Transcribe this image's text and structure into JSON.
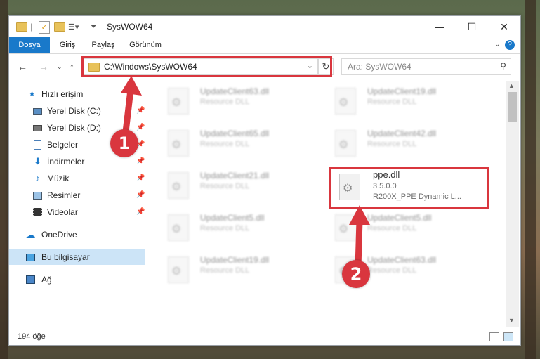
{
  "window": {
    "title": "SysWOW64",
    "controls": {
      "minimize": "—",
      "maximize": "☐",
      "close": "✕"
    }
  },
  "ribbon": {
    "tabs": [
      {
        "label": "Dosya",
        "active": true
      },
      {
        "label": "Giriş",
        "active": false
      },
      {
        "label": "Paylaş",
        "active": false
      },
      {
        "label": "Görünüm",
        "active": false
      }
    ],
    "help": "?"
  },
  "nav": {
    "address": "C:\\Windows\\SysWOW64",
    "search_placeholder": "Ara: SysWOW64"
  },
  "sidebar": {
    "items": [
      {
        "label": "Hızlı erişim",
        "icon": "star-icon",
        "pinned": false
      },
      {
        "label": "Yerel Disk (C:)",
        "icon": "drive-icon",
        "pinned": true
      },
      {
        "label": "Yerel Disk (D:)",
        "icon": "drive-icon",
        "pinned": true
      },
      {
        "label": "Belgeler",
        "icon": "documents-icon",
        "pinned": true
      },
      {
        "label": "İndirmeler",
        "icon": "downloads-icon",
        "pinned": true
      },
      {
        "label": "Müzik",
        "icon": "music-icon",
        "pinned": true
      },
      {
        "label": "Resimler",
        "icon": "pictures-icon",
        "pinned": true
      },
      {
        "label": "Videolar",
        "icon": "videos-icon",
        "pinned": true
      },
      {
        "label": "OneDrive",
        "icon": "cloud-icon",
        "pinned": false
      },
      {
        "label": "Bu bilgisayar",
        "icon": "computer-icon",
        "pinned": false,
        "selected": true
      },
      {
        "label": "Ağ",
        "icon": "network-icon",
        "pinned": false
      }
    ]
  },
  "files": [
    {
      "name": "UpdateClient63.dll",
      "desc": "Resource DLL"
    },
    {
      "name": "UpdateClient19.dll",
      "desc": "Resource DLL"
    },
    {
      "name": "UpdateClient65.dll",
      "desc": "Resource DLL"
    },
    {
      "name": "UpdateClient42.dll",
      "desc": "Resource DLL"
    },
    {
      "name": "UpdateClient21.dll",
      "desc": "Resource DLL"
    },
    {
      "name": "ppe.dll",
      "version": "3.5.0.0",
      "desc": "R200X_PPE Dynamic L..."
    },
    {
      "name": "UpdateClient5.dll",
      "desc": "Resource DLL"
    },
    {
      "name": "UpdateClient5.dll",
      "desc": "Resource DLL"
    },
    {
      "name": "UpdateClient19.dll",
      "desc": "Resource DLL"
    },
    {
      "name": "UpdateClient63.dll",
      "desc": "Resource DLL"
    }
  ],
  "status": {
    "count": "194 öğe"
  },
  "callouts": {
    "step1": "1",
    "step2": "2"
  },
  "colors": {
    "accent": "#1979ca",
    "highlight": "#d9363e",
    "selection": "#cce4f7"
  }
}
